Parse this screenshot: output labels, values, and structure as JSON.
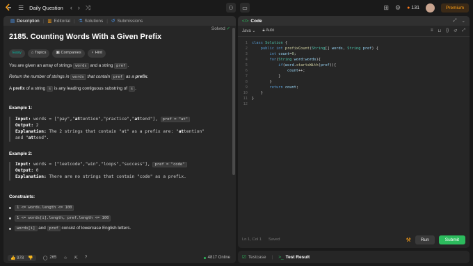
{
  "topbar": {
    "title": "Daily Question",
    "streak": "131",
    "premium": "Premium"
  },
  "left_tabs": [
    {
      "label": "Description",
      "icon": "document-icon"
    },
    {
      "label": "Editorial",
      "icon": "book-icon"
    },
    {
      "label": "Solutions",
      "icon": "flask-icon"
    },
    {
      "label": "Submissions",
      "icon": "history-icon"
    }
  ],
  "problem": {
    "title": "2185. Counting Words With a Given Prefix",
    "status": "Solved",
    "chips": [
      "Easy",
      "Topics",
      "Companies",
      "Hint"
    ],
    "p1_a": "You are given an array of strings ",
    "p1_code1": "words",
    "p1_b": " and a string ",
    "p1_code2": "pref",
    "p1_c": ".",
    "p2_a": "Return the number of strings in ",
    "p2_code1": "words",
    "p2_b": " that contain ",
    "p2_code2": "pref",
    "p2_c": " as a ",
    "p2_d": "prefix",
    "p2_e": ".",
    "p3_a": "A ",
    "p3_b": "prefix",
    "p3_c": " of a string ",
    "p3_code": "s",
    "p3_d": " is any leading contiguous substring of ",
    "p3_code2": "s",
    "p3_e": "."
  },
  "example1": {
    "heading": "Example 1:",
    "input_label": "Input:",
    "input_a": " words = [\"pay\",\"",
    "input_b": "at",
    "input_c": "tention\",\"practice\",\"",
    "input_d": "at",
    "input_e": "tend\"], ",
    "input_code": "pref = \"at\"",
    "output_label": "Output:",
    "output": " 2",
    "expl_label": "Explanation:",
    "expl_a": " The 2 strings that contain \"at\" as a prefix are: \"",
    "expl_b": "at",
    "expl_c": "tention\"",
    "expl_d": "and \"",
    "expl_e": "at",
    "expl_f": "tend\"."
  },
  "example2": {
    "heading": "Example 2:",
    "input_label": "Input:",
    "input": " words = [\"leetcode\",\"win\",\"loops\",\"success\"], ",
    "input_code": "pref = \"code\"",
    "output_label": "Output:",
    "output": " 0",
    "expl_label": "Explanation:",
    "expl": " There are no strings that contain \"code\" as a prefix."
  },
  "constraints": {
    "heading": "Constraints:",
    "c1": "1 <= words.length <= 100",
    "c2": "1 <= words[i].length, pref.length <= 100",
    "c3_code1": "words[i]",
    "c3_a": " and ",
    "c3_code2": "pref",
    "c3_b": " consist of lowercase English letters."
  },
  "left_footer": {
    "likes": "978",
    "comments": "265",
    "online": "4817 Online"
  },
  "code_panel": {
    "title": "Code",
    "language": "Java",
    "mode": "Auto",
    "status": "Ln 1, Col 1",
    "saved": "Saved",
    "run": "Run",
    "submit": "Submit"
  },
  "code_lines": [
    "1",
    "2",
    "3",
    "4",
    "5",
    "6",
    "7",
    "8",
    "9",
    "10",
    "11",
    "12"
  ],
  "bottom_tabs": [
    {
      "label": "Testcase"
    },
    {
      "label": "Test Result"
    }
  ]
}
